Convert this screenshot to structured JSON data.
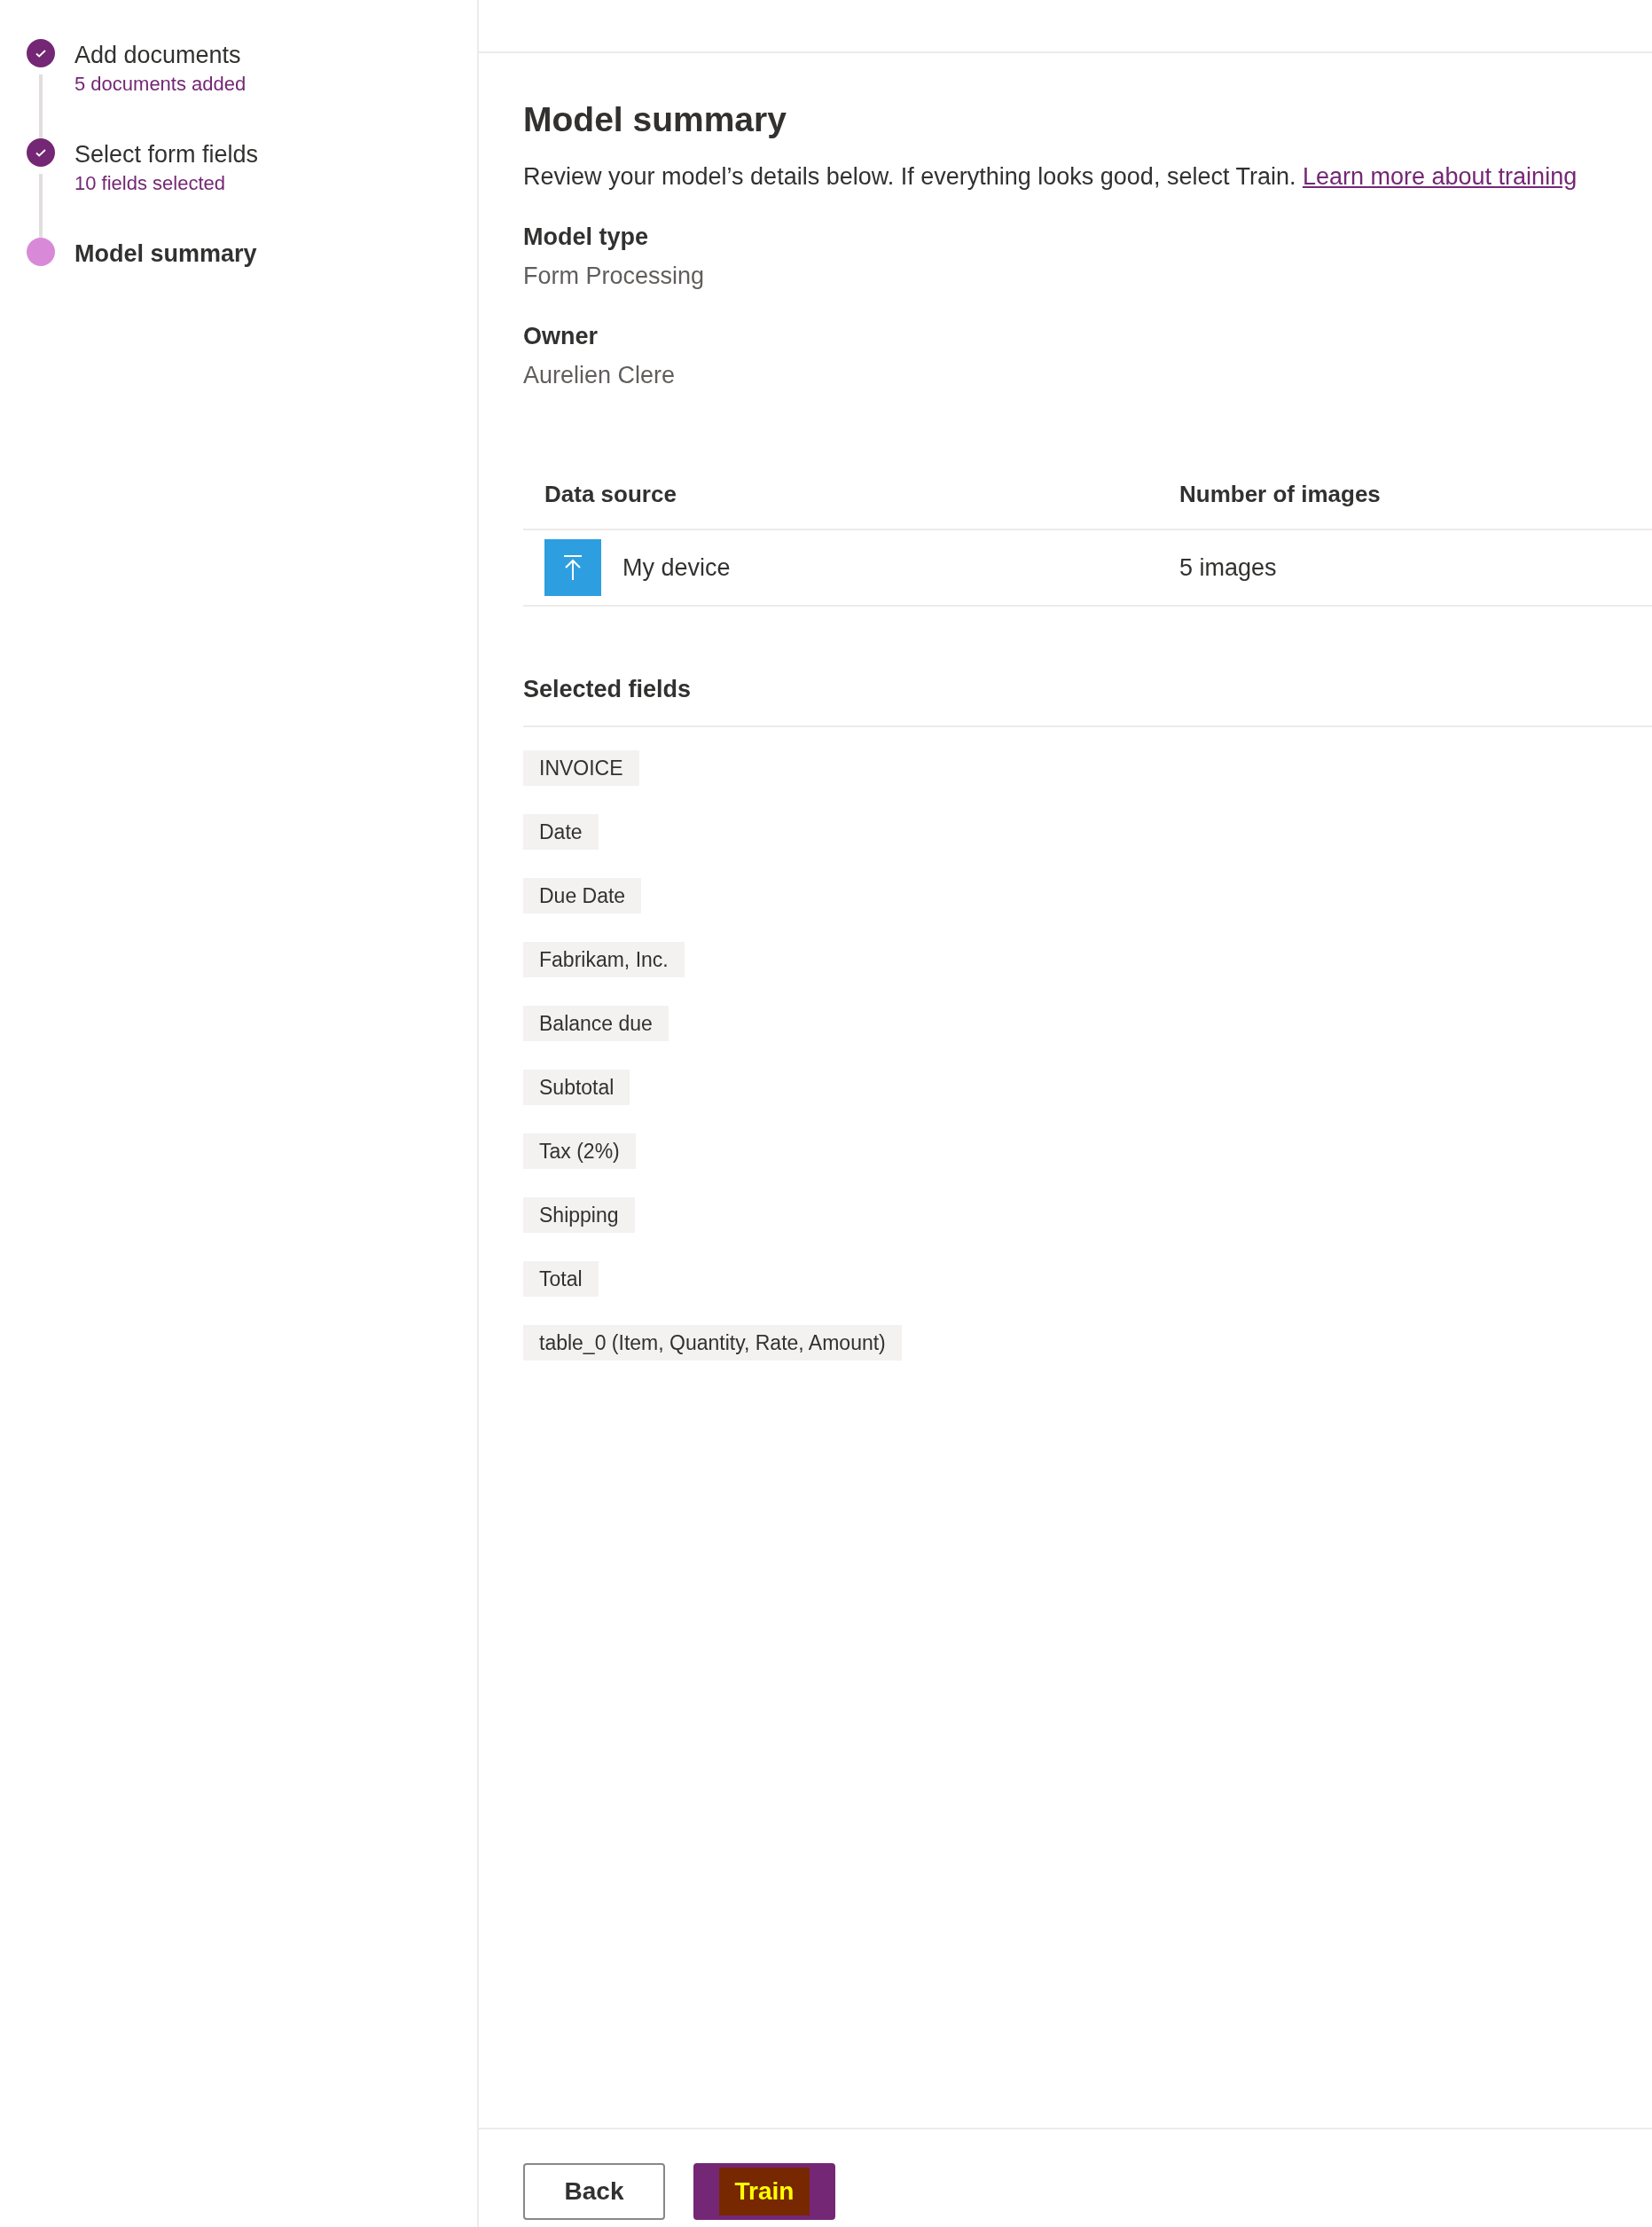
{
  "steps": [
    {
      "label": "Add documents",
      "detail": "5 documents added",
      "completed": true
    },
    {
      "label": "Select form fields",
      "detail": "10 fields selected",
      "completed": true
    },
    {
      "label": "Model summary",
      "completed": false
    }
  ],
  "heading": "Model summary",
  "intro": {
    "text": "Review your model’s details below. If everything looks good, select Train.",
    "link": "Learn more about training"
  },
  "details": [
    {
      "label": "Model type",
      "value": "Form Processing"
    },
    {
      "label": "Owner",
      "value": "Aurelien Clere"
    }
  ],
  "table": {
    "columns": [
      "Data source",
      "Number of images"
    ],
    "rows": [
      {
        "source": "My device",
        "count": "5 images"
      }
    ]
  },
  "selected_fields": {
    "title": "Selected fields",
    "items": [
      "INVOICE",
      "Date",
      "Due Date",
      "Fabrikam, Inc.",
      "Balance due",
      "Subtotal",
      "Tax (2%)",
      "Shipping",
      "Total",
      "table_0 (Item, Quantity, Rate, Amount)"
    ]
  },
  "buttons": [
    {
      "label": "Back",
      "kind": "secondary"
    },
    {
      "label": "Train",
      "kind": "primary"
    }
  ]
}
